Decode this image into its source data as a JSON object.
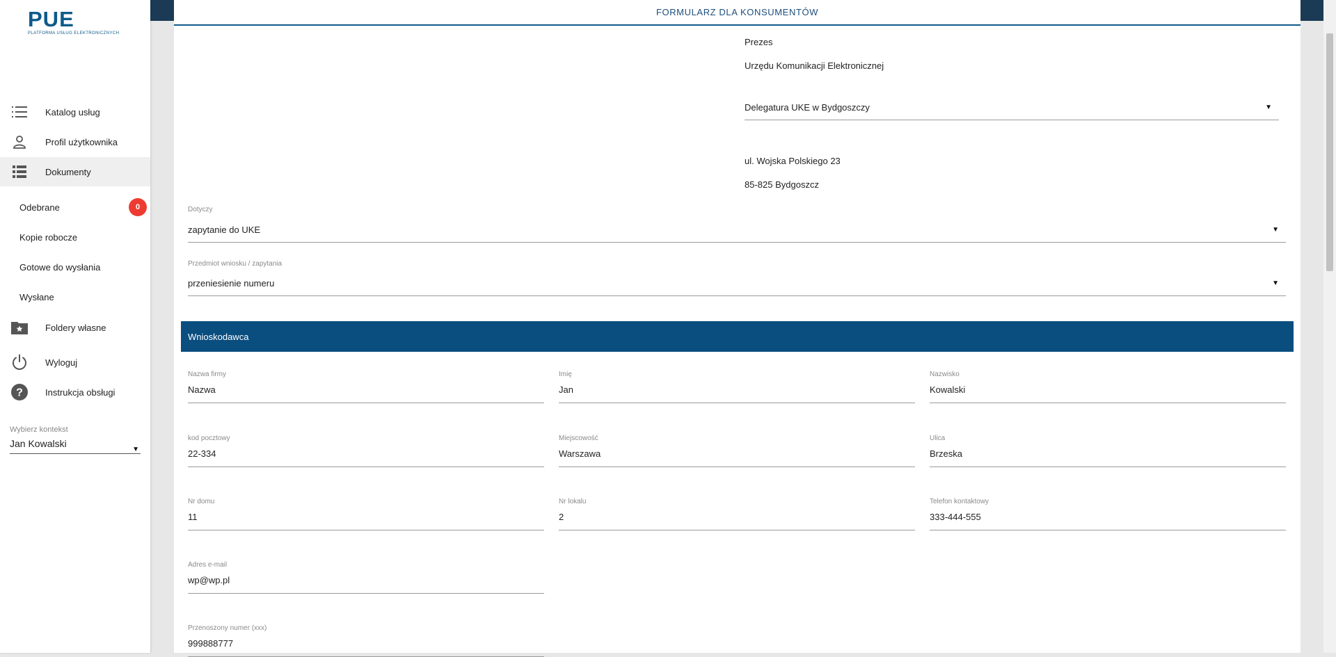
{
  "logo": {
    "title": "PUE",
    "subtitle": "PLATFORMA USŁUG ELEKTRONICZNYCH"
  },
  "sidebar": {
    "items": [
      {
        "label": "Katalog usług",
        "icon": "list-icon"
      },
      {
        "label": "Profil użytkownika",
        "icon": "person-icon"
      },
      {
        "label": "Dokumenty",
        "icon": "documents-icon"
      }
    ],
    "sub_items": [
      {
        "label": "Odebrane",
        "badge": "0"
      },
      {
        "label": "Kopie robocze"
      },
      {
        "label": "Gotowe do wysłania"
      },
      {
        "label": "Wysłane"
      }
    ],
    "bottom_items": [
      {
        "label": "Foldery własne",
        "icon": "folder-star-icon"
      },
      {
        "label": "Wyloguj",
        "icon": "power-icon"
      },
      {
        "label": "Instrukcja obsługi",
        "icon": "help-icon"
      }
    ],
    "context": {
      "label": "Wybierz kontekst",
      "value": "Jan Kowalski"
    }
  },
  "header": {
    "title": "FORMULARZ DLA KONSUMENTÓW"
  },
  "recipient": {
    "line1": "Prezes",
    "line2": "Urzędu Komunikacji Elektronicznej",
    "office": "Delegatura UKE w Bydgoszczy",
    "street": "ul. Wojska Polskiego 23",
    "city": "85-825 Bydgoszcz"
  },
  "form": {
    "dotyczy": {
      "label": "Dotyczy",
      "value": "zapytanie do UKE"
    },
    "przedmiot": {
      "label": "Przedmiot wniosku / zapytania",
      "value": "przeniesienie numeru"
    },
    "section_title": "Wnioskodawca",
    "fields": {
      "firma": {
        "label": "Nazwa firmy",
        "value": "Nazwa"
      },
      "imie": {
        "label": "Imię",
        "value": "Jan"
      },
      "nazwisko": {
        "label": "Nazwisko",
        "value": "Kowalski"
      },
      "kod": {
        "label": "kod pocztowy",
        "value": "22-334"
      },
      "miejscowosc": {
        "label": "Miejscowość",
        "value": "Warszawa"
      },
      "ulica": {
        "label": "Ulica",
        "value": "Brzeska"
      },
      "nr_domu": {
        "label": "Nr domu",
        "value": "11"
      },
      "nr_lokalu": {
        "label": "Nr lokalu",
        "value": "2"
      },
      "telefon": {
        "label": "Telefon kontaktowy",
        "value": "333-444-555"
      },
      "email": {
        "label": "Adres e-mail",
        "value": "wp@wp.pl"
      },
      "przenoszony": {
        "label": "Przenoszony numer (xxx)",
        "value": "999888777"
      }
    }
  },
  "colors": {
    "brand": "#0e5a8a",
    "section": "#0a4d7f",
    "badge": "#ee3b32",
    "topbar": "#1a3a55"
  }
}
